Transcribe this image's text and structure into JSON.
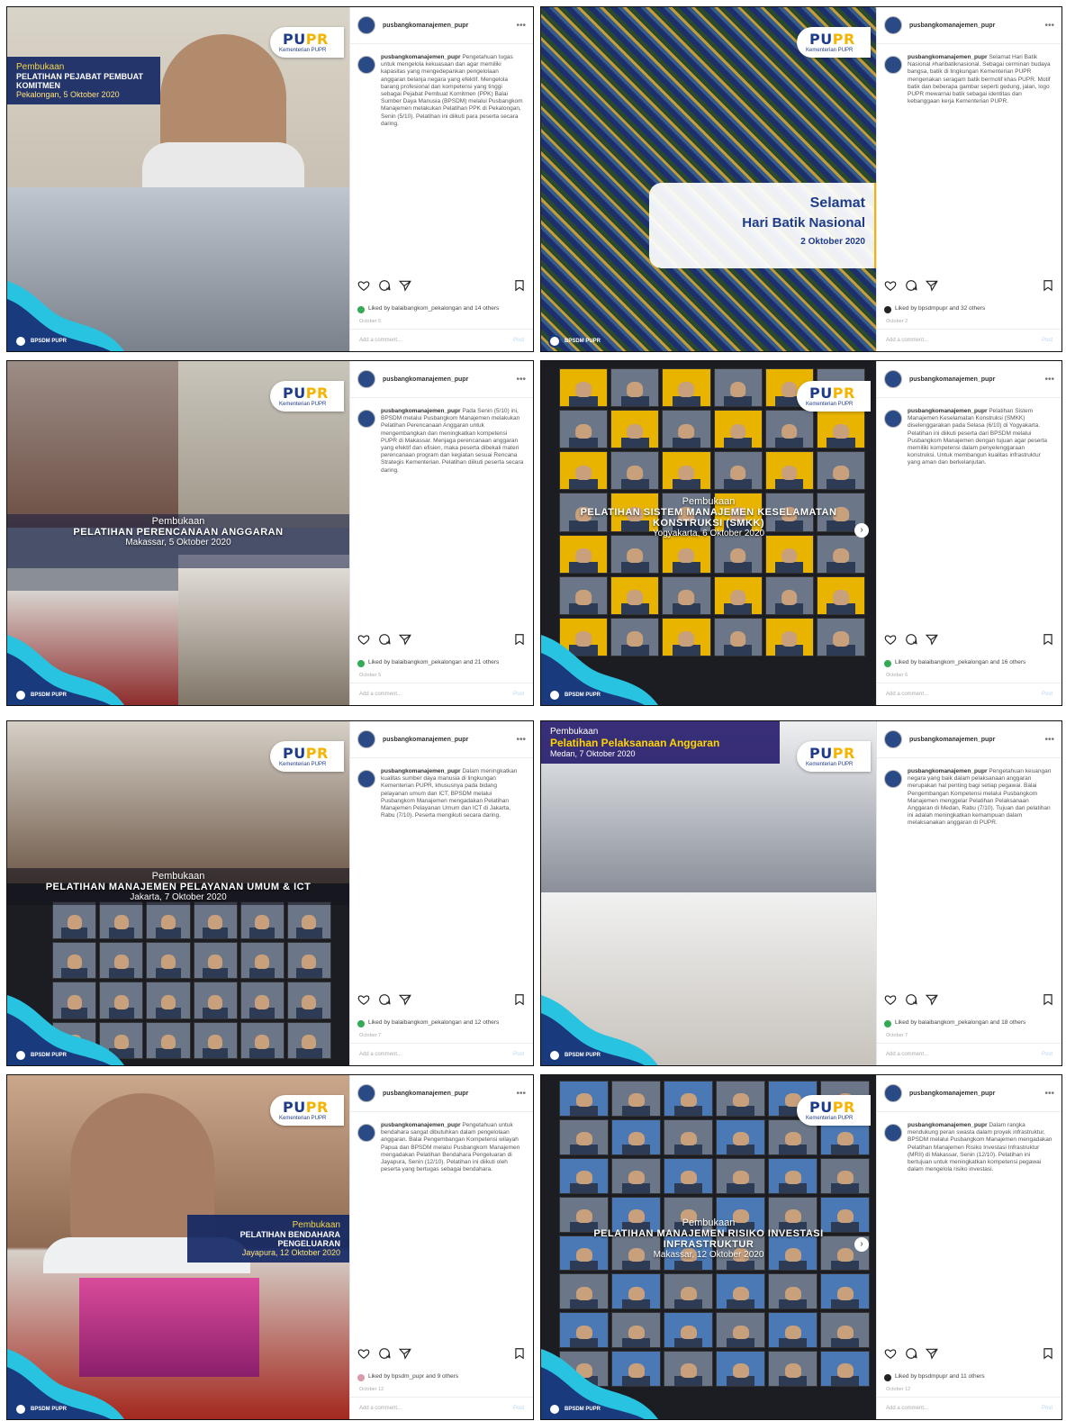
{
  "brand": {
    "logo_left": "PU",
    "logo_right": "PR",
    "logo_sub": "Kementerian PUPR",
    "institute": "BPSDM PUPR"
  },
  "ui": {
    "more": "•••",
    "comment_placeholder": "Add a comment...",
    "post_label": "Post"
  },
  "posts": [
    {
      "account": "pusbangkomanajemen_pupr",
      "kicker": "Pembukaan",
      "title": "PELATIHAN PEJABAT PEMBUAT KOMITMEN",
      "date": "Pekalongan, 5 Oktober 2020",
      "caption_user": "pusbangkomanajemen_pupr",
      "caption": "Pengetahuan tugas untuk mengelola kekuasaan dan agar memiliki kapasitas yang mengedepankan pengelolaan anggaran belanja negara yang efektif. Mengelola barang profesional dan kompetensi yang tinggi sebagai Pejabat Pembuat Komitmen (PPK) Balai Sumber Daya Manusia (BPSDM) melalui Pusbangkom Manajemen melakukan Pelatihan PPK di Pekalongan, Senin (5/10). Pelatihan ini diikuti para peserta secara daring.",
      "likes": "Liked by balaibangkom_pekalongan and 14 others",
      "ago": "October 5"
    },
    {
      "account": "pusbangkomanajemen_pupr",
      "kicker": "Selamat",
      "title": "Hari Batik Nasional",
      "date": "2 Oktober 2020",
      "caption_user": "pusbangkomanajemen_pupr",
      "caption": "Selamat Hari Batik Nasional #haribatiknasional. Sebagai cerminan budaya bangsa, batik di lingkungan Kementerian PUPR mengenakan seragam batik bermotif khas PUPR. Motif batik dan beberapa gambar seperti gedung, jalan, logo PUPR mewarnai batik sebagai identitas dan kebanggaan kerja Kementerian PUPR.",
      "likes": "Liked by bpsdmpupr and 32 others",
      "ago": "October 2"
    },
    {
      "account": "pusbangkomanajemen_pupr",
      "kicker": "Pembukaan",
      "title": "PELATIHAN PERENCANAAN ANGGARAN",
      "date": "Makassar, 5 Oktober 2020",
      "caption_user": "pusbangkomanajemen_pupr",
      "caption": "Pada Senin (5/10) ini, BPSDM melalui Pusbangkom Manajemen melakukan Pelatihan Perencanaan Anggaran untuk mengembangkan dan meningkatkan kompetensi PUPR di Makassar. Menjaga perencanaan anggaran yang efektif dan efisien, maka peserta dibekali materi perencanaan program dan kegiatan sesuai Rencana Strategis Kementerian. Pelatihan diikuti peserta secara daring.",
      "likes": "Liked by balaibangkom_pekalongan and 21 others",
      "ago": "October 5"
    },
    {
      "account": "pusbangkomanajemen_pupr",
      "kicker": "Pembukaan",
      "title": "PELATIHAN SISTEM MANAJEMEN KESELAMATAN KONSTRUKSI (SMKK)",
      "date": "Yogyakarta, 6 Oktober 2020",
      "caption_user": "pusbangkomanajemen_pupr",
      "caption": "Pelatihan Sistem Manajemen Keselamatan Konstruksi (SMKK) diselenggarakan pada Selasa (6/10) di Yogyakarta. Pelatihan ini diikuti peserta dari BPSDM melalui Pusbangkom Manajemen dengan tujuan agar peserta memiliki kompetensi dalam penyelenggaraan konstruksi. Untuk membangun kualitas infrastruktur yang aman dan berkelanjutan.",
      "likes": "Liked by balaibangkom_pekalongan and 16 others",
      "ago": "October 6"
    },
    {
      "account": "pusbangkomanajemen_pupr",
      "kicker": "Pembukaan",
      "title": "PELATIHAN MANAJEMEN PELAYANAN UMUM & ICT",
      "date": "Jakarta, 7 Oktober 2020",
      "caption_user": "pusbangkomanajemen_pupr",
      "caption": "Dalam meningkatkan kualitas sumber daya manusia di lingkungan Kementerian PUPR, khususnya pada bidang pelayanan umum dan ICT, BPSDM melalui Pusbangkom Manajemen mengadakan Pelatihan Manajemen Pelayanan Umum dan ICT di Jakarta, Rabu (7/10). Peserta mengikuti secara daring.",
      "likes": "Liked by balaibangkom_pekalongan and 12 others",
      "ago": "October 7"
    },
    {
      "account": "pusbangkomanajemen_pupr",
      "kicker": "Pembukaan",
      "title": "Pelatihan Pelaksanaan Anggaran",
      "date": "Medan, 7 Oktober 2020",
      "caption_user": "pusbangkomanajemen_pupr",
      "caption": "Pengetahuan keuangan negara yang baik dalam pelaksanaan anggaran merupakan hal penting bagi setiap pegawai. Balai Pengembangan Kompetensi melalui Pusbangkom Manajemen menggelar Pelatihan Pelaksanaan Anggaran di Medan, Rabu (7/10). Tujuan dari pelatihan ini adalah meningkatkan kemampuan dalam melaksanakan anggaran di PUPR.",
      "likes": "Liked by balaibangkom_pekalongan and 18 others",
      "ago": "October 7"
    },
    {
      "account": "pusbangkomanajemen_pupr",
      "kicker": "Pembukaan",
      "title": "PELATIHAN BENDAHARA PENGELUARAN",
      "date": "Jayapura, 12 Oktober 2020",
      "caption_user": "pusbangkomanajemen_pupr",
      "caption": "Pengetahuan untuk bendahara sangat dibutuhkan dalam pengelolaan anggaran. Balai Pengembangan Kompetensi wilayah Papua dan BPSDM melalui Pusbangkom Manajemen mengadakan Pelatihan Bendahara Pengeluaran di Jayapura, Senin (12/10). Pelatihan ini diikuti oleh peserta yang bertugas sebagai bendahara.",
      "likes": "Liked by bpsdm_pupr and 9 others",
      "ago": "October 12"
    },
    {
      "account": "pusbangkomanajemen_pupr",
      "kicker": "Pembukaan",
      "title": "PELATIHAN MANAJEMEN RISIKO INVESTASI INFRASTRUKTUR",
      "date": "Makassar, 12 Oktober 2020",
      "caption_user": "pusbangkomanajemen_pupr",
      "caption": "Dalam rangka mendukung peran swasta dalam proyek infrastruktur, BPSDM melalui Pusbangkom Manajemen mengadakan Pelatihan Manajemen Risiko Investasi Infrastruktur (MRII) di Makassar, Senin (12/10). Pelatihan ini bertujuan untuk meningkatkan kompetensi pegawai dalam mengelola risiko investasi.",
      "likes": "Liked by bpsdmpupr and 11 others",
      "ago": "October 12"
    }
  ]
}
